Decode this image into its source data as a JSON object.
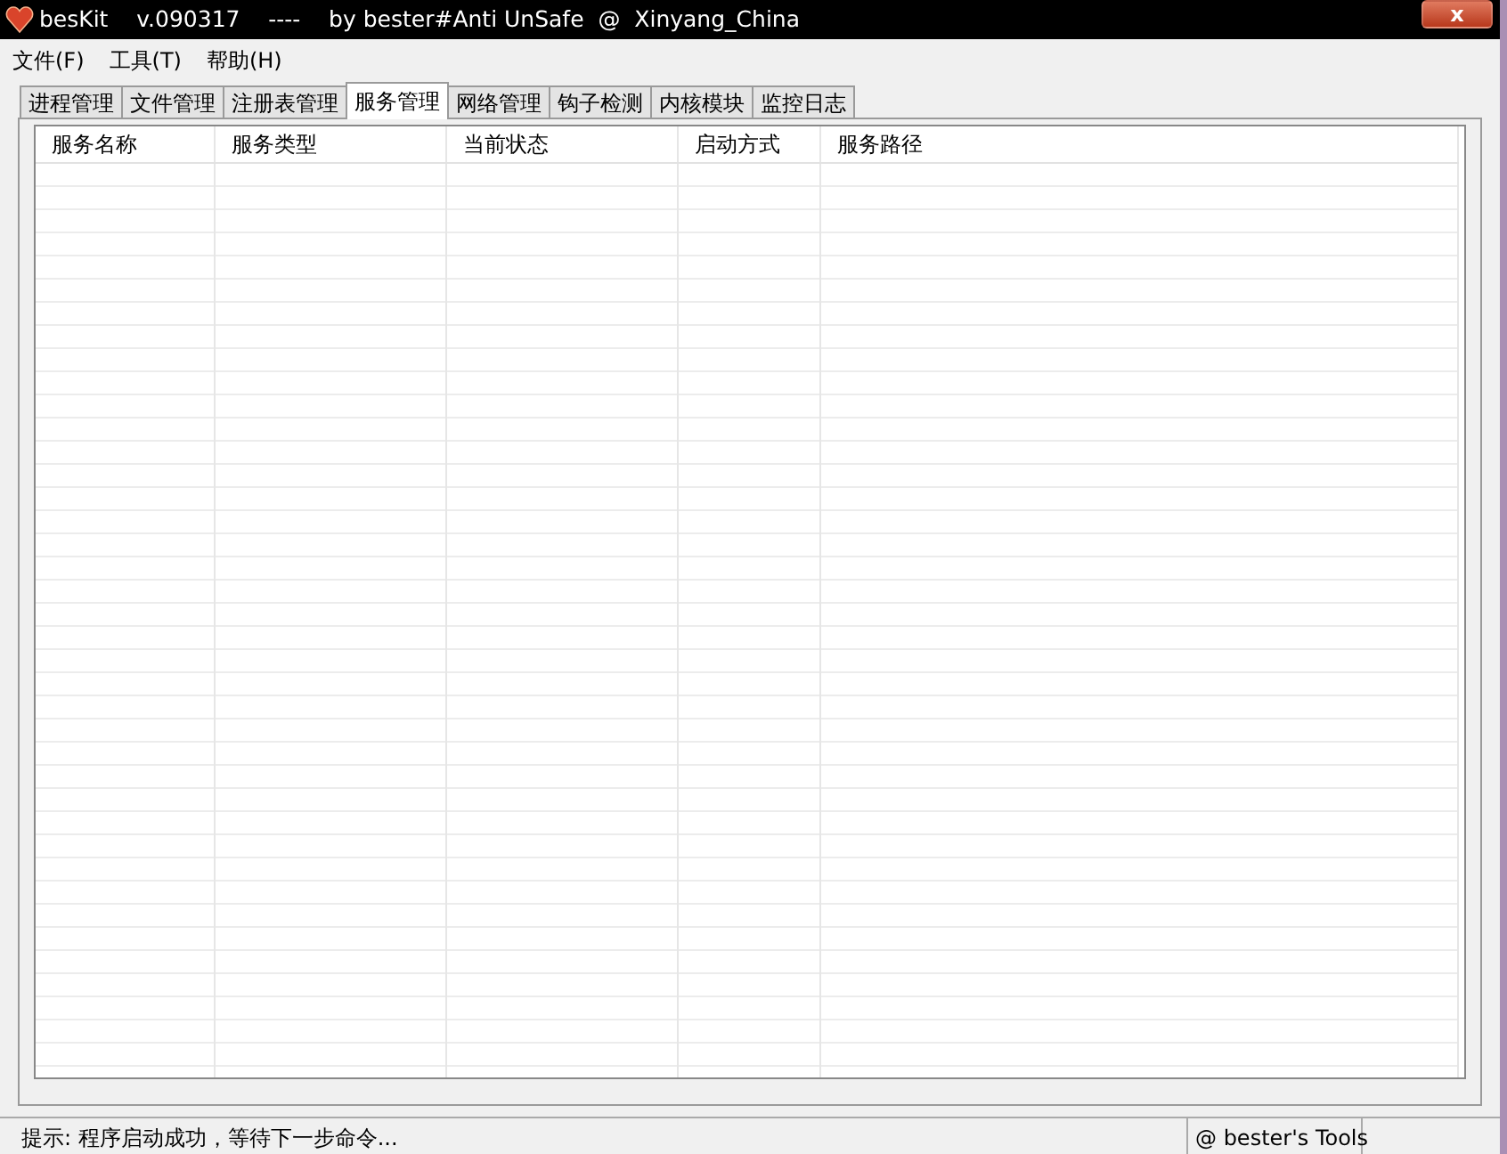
{
  "window": {
    "title": "besKit    v.090317    ----    by bester#Anti UnSafe  @  Xinyang_China",
    "close": "x"
  },
  "menu": [
    "文件(F)",
    "工具(T)",
    "帮助(H)"
  ],
  "tabs": [
    {
      "label": "进程管理",
      "selected": false
    },
    {
      "label": "文件管理",
      "selected": false
    },
    {
      "label": "注册表管理",
      "selected": false
    },
    {
      "label": "服务管理",
      "selected": true
    },
    {
      "label": "网络管理",
      "selected": false
    },
    {
      "label": "钩子检测",
      "selected": false
    },
    {
      "label": "内核模块",
      "selected": false
    },
    {
      "label": "监控日志",
      "selected": false
    }
  ],
  "table": {
    "columns": [
      "服务名称",
      "服务类型",
      "当前状态",
      "启动方式",
      "服务路径"
    ]
  },
  "status_bar": [
    "提示:  程序启动成功，等待下一步命令...",
    "@ bester's Tools"
  ]
}
